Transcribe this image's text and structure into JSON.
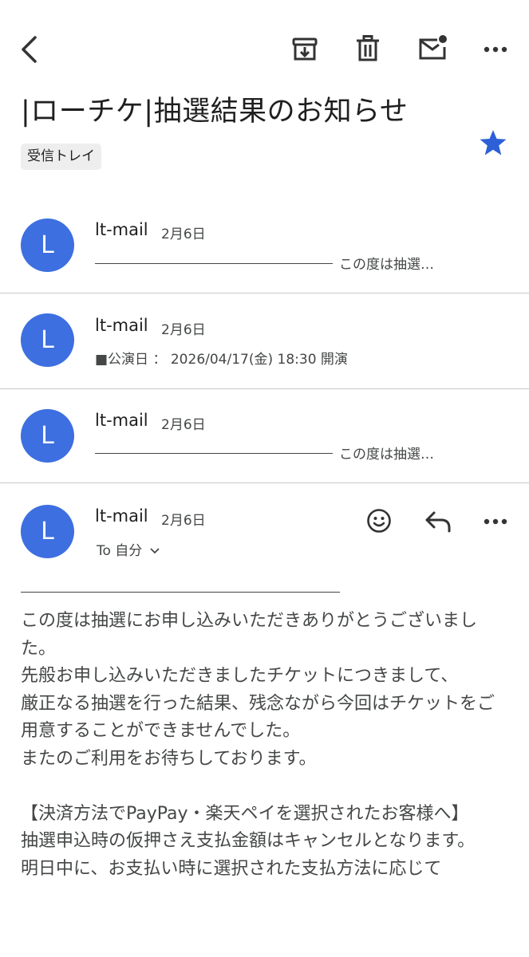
{
  "toolbar": {
    "back_icon": "back-arrow-icon",
    "archive_icon": "archive-icon",
    "delete_icon": "trash-icon",
    "mark_unread_icon": "mark-unread-icon",
    "more_icon": "more-horizontal-icon"
  },
  "thread": {
    "subject": "|ローチケ|抽選結果のお知らせ",
    "label": "受信トレイ",
    "starred": true,
    "star_color": "#2d5fd6"
  },
  "messages": [
    {
      "avatar_letter": "L",
      "sender": "lt-mail",
      "date": "2月6日",
      "snippet": "この度は抽選…",
      "snippet_has_rule": true
    },
    {
      "avatar_letter": "L",
      "sender": "lt-mail",
      "date": "2月6日",
      "snippet": "■公演日 ： 2026/04/17(金) 18:30 開演",
      "snippet_has_rule": false
    },
    {
      "avatar_letter": "L",
      "sender": "lt-mail",
      "date": "2月6日",
      "snippet": "この度は抽選…",
      "snippet_has_rule": true
    }
  ],
  "open_message": {
    "avatar_letter": "L",
    "sender": "lt-mail",
    "date": "2月6日",
    "recipient": "To 自分",
    "emoji_icon": "emoji-icon",
    "reply_icon": "reply-icon",
    "more_icon": "more-horizontal-icon",
    "body": "この度は抽選にお申し込みいただきありがとうございました。\n先般お申し込みいただきましたチケットにつきまして、\n厳正なる抽選を行った結果、残念ながら今回はチケットをご用意することができませんでした。\nまたのご利用をお待ちしております。\n\n【決済方法でPayPay・楽天ペイを選択されたお客様へ】\n抽選申込時の仮押さえ支払金額はキャンセルとなります。\n明日中に、お支払い時に選択された支払方法に応じて"
  },
  "colors": {
    "avatar": "#3d6fe0",
    "text_primary": "#1f1f1f",
    "text_secondary": "#444746",
    "divider": "#c9c9c9"
  }
}
